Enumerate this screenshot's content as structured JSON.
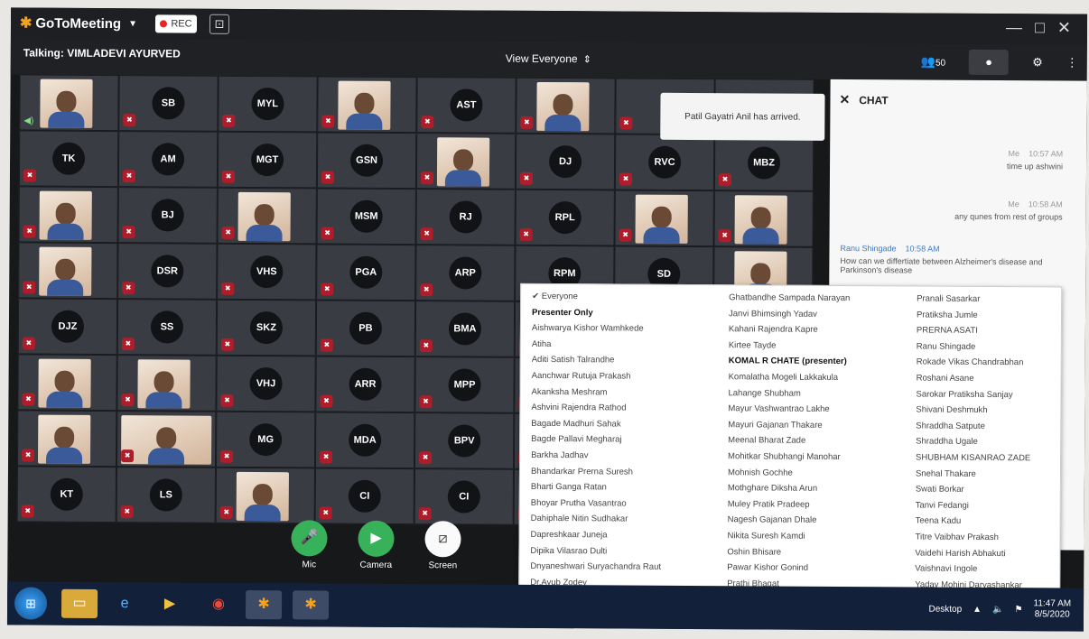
{
  "app": {
    "name": "GoToMeeting",
    "rec_label": "REC"
  },
  "topbar": {
    "talking": "Talking: VIMLADEVI AYURVED",
    "view": "View Everyone",
    "attendee_count": "50"
  },
  "tiles": [
    {
      "type": "video",
      "speaker": true
    },
    {
      "initials": "SB"
    },
    {
      "initials": "MYL"
    },
    {
      "type": "video"
    },
    {
      "initials": "AST"
    },
    {
      "type": "video"
    },
    {
      "initials": ""
    },
    {
      "initials": ""
    },
    {
      "initials": "TK"
    },
    {
      "initials": "AM"
    },
    {
      "initials": "MGT"
    },
    {
      "initials": "GSN"
    },
    {
      "type": "video"
    },
    {
      "initials": "DJ"
    },
    {
      "initials": "RVC"
    },
    {
      "initials": "MBZ"
    },
    {
      "type": "video"
    },
    {
      "initials": "BJ"
    },
    {
      "type": "video"
    },
    {
      "initials": "MSM"
    },
    {
      "initials": "RJ"
    },
    {
      "initials": "RPL"
    },
    {
      "type": "video"
    },
    {
      "type": "video"
    },
    {
      "type": "video"
    },
    {
      "initials": "DSR"
    },
    {
      "initials": "VHS"
    },
    {
      "initials": "PGA"
    },
    {
      "initials": "ARP"
    },
    {
      "initials": "RPM"
    },
    {
      "initials": "SD"
    },
    {
      "type": "video"
    },
    {
      "initials": "DJZ"
    },
    {
      "initials": "SS"
    },
    {
      "initials": "SKZ"
    },
    {
      "initials": "PB"
    },
    {
      "initials": "BMA"
    },
    {
      "initials": ""
    },
    {
      "initials": ""
    },
    {
      "initials": ""
    },
    {
      "type": "video"
    },
    {
      "type": "video"
    },
    {
      "initials": "VHJ"
    },
    {
      "initials": "ARR"
    },
    {
      "initials": "MPP"
    },
    {
      "initials": ""
    },
    {
      "initials": ""
    },
    {
      "initials": ""
    },
    {
      "type": "video"
    },
    {
      "type": "video-wide"
    },
    {
      "initials": "MG"
    },
    {
      "initials": "MDA"
    },
    {
      "initials": "BPV"
    },
    {
      "initials": ""
    },
    {
      "initials": ""
    },
    {
      "initials": ""
    },
    {
      "initials": "KT"
    },
    {
      "initials": "LS"
    },
    {
      "type": "video"
    },
    {
      "initials": "CI"
    },
    {
      "initials": "CI"
    },
    {
      "initials": ""
    },
    {
      "initials": ""
    },
    {
      "initials": ""
    }
  ],
  "notice": "Patil Gayatri Anil has arrived.",
  "chat": {
    "title": "CHAT",
    "messages": [
      {
        "from": "Me",
        "time": "10:57 AM",
        "text": "time up ashwini"
      },
      {
        "from": "Me",
        "time": "10:58 AM",
        "text": "any qunes from rest of groups"
      },
      {
        "from": "Ranu Shingade",
        "time": "10:58 AM",
        "text": "How can we differtiate between Alzheimer's disease and Parkinson's disease"
      }
    ]
  },
  "recipients": {
    "col1": [
      "Everyone",
      "Presenter Only",
      "Aishwarya Kishor Wamhkede",
      "Atiha",
      "Aditi Satish Talrandhe",
      "Aanchwar Rutuja Prakash",
      "Akanksha Meshram",
      "Ashvini Rajendra Rathod",
      "Bagade Madhuri Sahak",
      "Bagde Pallavi Megharaj",
      "Barkha Jadhav",
      "Bhandarkar Prerna Suresh",
      "Bharti Ganga Ratan",
      "Bhoyar Prutha Vasantrao",
      "Dahiphale Nitin Sudhakar",
      "Dapreshkaar Juneja",
      "Dipika Vilasrao Dulti",
      "Dnyaneshwari Suryachandra Raut",
      "Dr.Ayub Zodey"
    ],
    "col2": [
      "Ghatbandhe Sampada Narayan",
      "Janvi Bhimsingh Yadav",
      "Kahani Rajendra Kapre",
      "Kirtee Tayde",
      "KOMAL R CHATE (presenter)",
      "Komalatha Mogeli Lakkakula",
      "Lahange Shubham",
      "Mayur Vashwantrao Lakhe",
      "Mayuri Gajanan Thakare",
      "Meenal Bharat Zade",
      "Mohitkar Shubhangi Manohar",
      "Mohnish Gochhe",
      "Mothghare Diksha Arun",
      "Muley Pratik Pradeep",
      "Nagesh Gajanan Dhale",
      "Nikita Suresh Kamdi",
      "Oshin Bhisare",
      "Pawar Kishor Gonind",
      "Prathi Bhagat"
    ],
    "col3": [
      "Pranali Sasarkar",
      "Pratiksha Jumle",
      "PRERNA ASATI",
      "Ranu Shingade",
      "Rokade Vikas Chandrabhan",
      "Roshani Asane",
      "Sarokar Pratiksha Sanjay",
      "Shivani Deshmukh",
      "Shraddha Satpute",
      "Shraddha Ugale",
      "SHUBHAM KISANRAO ZADE",
      "Snehal Thakare",
      "Swati Borkar",
      "Tanvi Fedangi",
      "Teena Kadu",
      "Titre Vaibhav Prakash",
      "Vaidehi Harish Abhakuti",
      "Vaishnavi Ingole",
      "Yadav Mohini Daryashankar"
    ]
  },
  "controls": [
    {
      "label": "Mic",
      "icon": "mic-icon"
    },
    {
      "label": "Camera",
      "icon": "camera-icon"
    },
    {
      "label": "Screen",
      "icon": "screen-icon"
    }
  ],
  "taskbar": {
    "desktop": "Desktop",
    "time": "11:47 AM",
    "date": "8/5/2020"
  }
}
